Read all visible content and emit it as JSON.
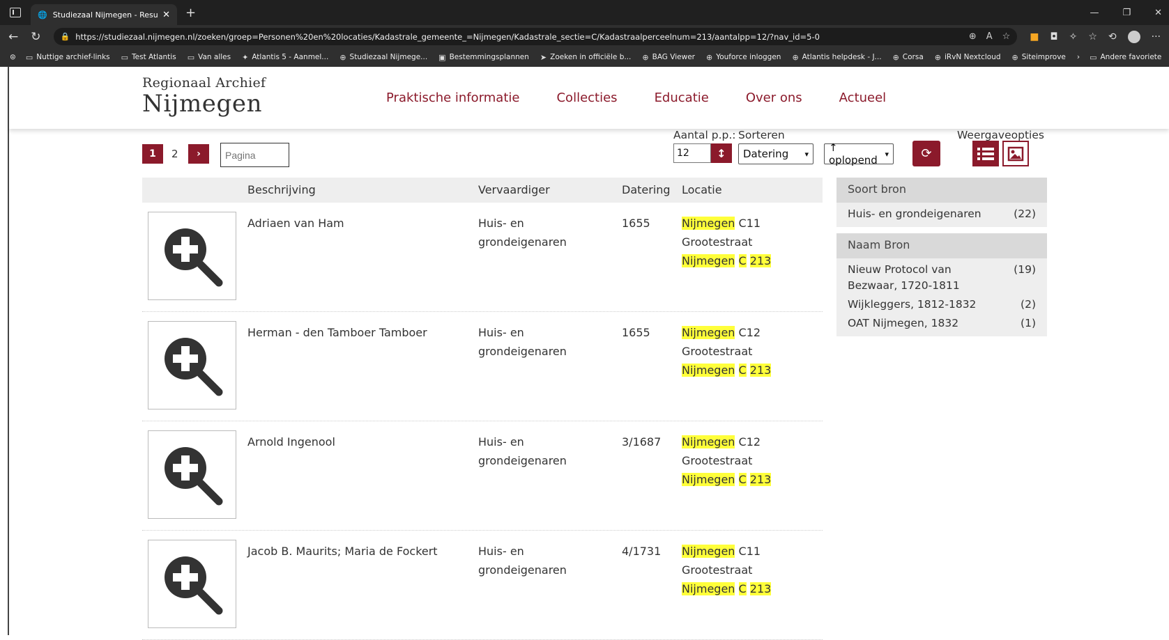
{
  "browser": {
    "tab_title": "Studiezaal Nijmegen - Resultaten",
    "url": "https://studiezaal.nijmegen.nl/zoeken/groep=Personen%20en%20locaties/Kadastrale_gemeente_=Nijmegen/Kadastrale_sectie=C/Kadastraalperceelnum=213/aantalpp=12/?nav_id=5-0",
    "bookmarks": [
      {
        "label": "Nuttige archief-links",
        "icon": "folder-icon"
      },
      {
        "label": "Test Atlantis",
        "icon": "folder-icon"
      },
      {
        "label": "Van alles",
        "icon": "folder-icon"
      },
      {
        "label": "Atlantis 5 - Aanmel...",
        "icon": "atlantis-icon"
      },
      {
        "label": "Studiezaal Nijmege...",
        "icon": "globe-icon"
      },
      {
        "label": "Bestemmingsplannen",
        "icon": "pdf-icon"
      },
      {
        "label": "Zoeken in officiële b...",
        "icon": "arrow-icon"
      },
      {
        "label": "BAG Viewer",
        "icon": "globe-icon"
      },
      {
        "label": "Youforce inloggen",
        "icon": "globe-icon"
      },
      {
        "label": "Atlantis helpdesk - J...",
        "icon": "globe-icon"
      },
      {
        "label": "Corsa",
        "icon": "globe-icon"
      },
      {
        "label": "iRvN Nextcloud",
        "icon": "globe-icon"
      },
      {
        "label": "Siteimprove",
        "icon": "globe-icon"
      }
    ],
    "other_favorites": "Andere favoriete"
  },
  "site": {
    "logo_top": "Regionaal Archief",
    "logo_main": "Nijmegen",
    "nav": [
      "Praktische informatie",
      "Collecties",
      "Educatie",
      "Over ons",
      "Actueel"
    ]
  },
  "toolbar": {
    "page_current": "1",
    "page_next": "2",
    "page_placeholder": "Pagina",
    "per_page_label": "Aantal p.p.:",
    "per_page_value": "12",
    "sort_label": "Sorteren",
    "sort_value": "Datering",
    "order_value": "↑ oplopend",
    "view_label": "Weergaveopties"
  },
  "table": {
    "headers": {
      "desc": "Beschrijving",
      "maker": "Vervaardiger",
      "date": "Datering",
      "location": "Locatie"
    },
    "rows": [
      {
        "desc": "Adriaen van Ham",
        "maker": "Huis- en grondeigenaren",
        "date": "1655",
        "loc_city": "Nijmegen",
        "loc_code": "C11",
        "loc_street": "Grootestraat",
        "loc2_city": "Nijmegen",
        "loc2_sect": "C",
        "loc2_num": "213"
      },
      {
        "desc": "Herman - den Tamboer Tamboer",
        "maker": "Huis- en grondeigenaren",
        "date": "1655",
        "loc_city": "Nijmegen",
        "loc_code": "C12",
        "loc_street": "Grootestraat",
        "loc2_city": "Nijmegen",
        "loc2_sect": "C",
        "loc2_num": "213"
      },
      {
        "desc": "Arnold Ingenool",
        "maker": "Huis- en grondeigenaren",
        "date": "3/1687",
        "loc_city": "Nijmegen",
        "loc_code": "C12",
        "loc_street": "Grootestraat",
        "loc2_city": "Nijmegen",
        "loc2_sect": "C",
        "loc2_num": "213"
      },
      {
        "desc": "Jacob B. Maurits; Maria de Fockert",
        "maker": "Huis- en grondeigenaren",
        "date": "4/1731",
        "loc_city": "Nijmegen",
        "loc_code": "C11",
        "loc_street": "Grootestraat",
        "loc2_city": "Nijmegen",
        "loc2_sect": "C",
        "loc2_num": "213"
      }
    ]
  },
  "facets": [
    {
      "title": "Soort bron",
      "items": [
        {
          "label": "Huis- en grondeigenaren",
          "count": "(22)"
        }
      ]
    },
    {
      "title": "Naam Bron",
      "items": [
        {
          "label": "Nieuw Protocol van Bezwaar, 1720-1811",
          "count": "(19)"
        },
        {
          "label": "Wijkleggers, 1812-1832",
          "count": "(2)"
        },
        {
          "label": "OAT Nijmegen, 1832",
          "count": "(1)"
        }
      ]
    }
  ],
  "colors": {
    "brand": "#8b1a2b",
    "highlight": "#ffff3a"
  }
}
